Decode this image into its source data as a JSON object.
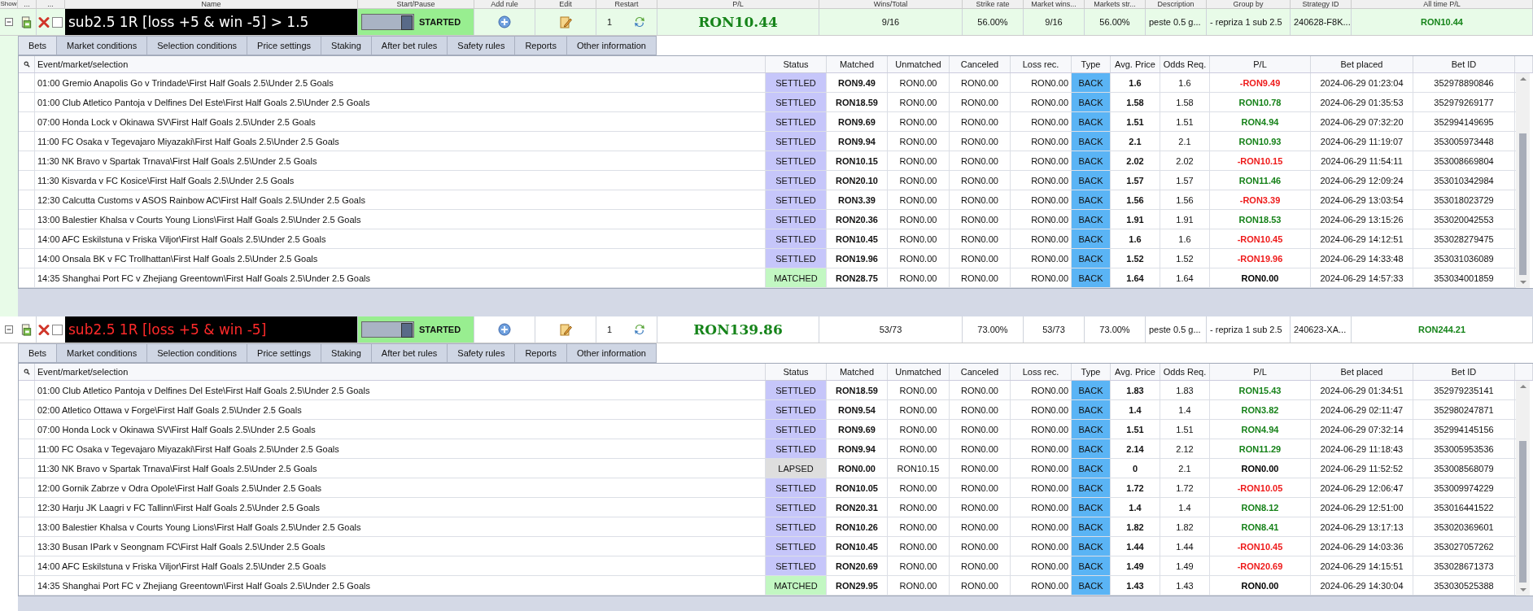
{
  "columns": [
    "Show",
    "...",
    "...",
    "Name",
    "Start/Pause",
    "Add rule",
    "Edit",
    "Restart",
    "P/L",
    "Wins/Total",
    "Strike rate",
    "Market wins...",
    "Markets str...",
    "Description",
    "Group by",
    "Strategy ID",
    "All time P/L"
  ],
  "strategies": [
    {
      "selected": true,
      "expanded": true,
      "checked": false,
      "name": "sub2.5 1R [loss +5 & win -5] > 1.5",
      "name_alert": false,
      "running": true,
      "state": "STARTED",
      "restart": "1",
      "pl": "RON10.44",
      "wins_total": "9/16",
      "strike_rate": "56.00%",
      "market_wins": "9/16",
      "markets_strike": "56.00%",
      "description": "peste 0.5 g...",
      "group_by": "- repriza 1 sub 2.5",
      "strategy_id": "240628-F8K...",
      "all_time_pl": "RON10.44",
      "tabs": [
        {
          "label": "Bets",
          "selected": true
        },
        {
          "label": "Market conditions",
          "selected": false
        },
        {
          "label": "Selection conditions",
          "selected": false
        },
        {
          "label": "Price settings",
          "selected": false
        },
        {
          "label": "Staking",
          "selected": false
        },
        {
          "label": "After bet rules",
          "selected": false
        },
        {
          "label": "Safety rules",
          "selected": false
        },
        {
          "label": "Reports",
          "selected": false
        },
        {
          "label": "Other information",
          "selected": false
        }
      ],
      "table_columns": [
        "Event/market/selection",
        "Status",
        "Matched",
        "Unmatched",
        "Canceled",
        "Loss rec.",
        "Type",
        "Avg. Price",
        "Odds Req.",
        "P/L",
        "Bet placed",
        "Bet ID"
      ],
      "bets": [
        {
          "kind": "settled",
          "event": "01:00 Gremio Anapolis Go v Trindade\\First Half Goals 2.5\\Under 2.5 Goals",
          "status": "SETTLED",
          "matched": "RON9.49",
          "unmatched": "RON0.00",
          "canceled": "RON0.00",
          "loss_rec": "RON0.00",
          "type": "BACK",
          "avg_price": "1.6",
          "odds_req": "1.6",
          "pl": {
            "text": "-RON9.49",
            "color": "#ee1b1b"
          },
          "bet_placed": "2024-06-29 01:23:04",
          "bet_id": "352978890846"
        },
        {
          "kind": "settled",
          "event": "01:00 Club Atletico Pantoja v Delfines Del Este\\First Half Goals 2.5\\Under 2.5 Goals",
          "status": "SETTLED",
          "matched": "RON18.59",
          "unmatched": "RON0.00",
          "canceled": "RON0.00",
          "loss_rec": "RON0.00",
          "type": "BACK",
          "avg_price": "1.58",
          "odds_req": "1.58",
          "pl": {
            "text": "RON10.78",
            "color": "#17821a"
          },
          "bet_placed": "2024-06-29 01:35:53",
          "bet_id": "352979269177"
        },
        {
          "kind": "settled",
          "event": "07:00 Honda Lock v Okinawa SV\\First Half Goals 2.5\\Under 2.5 Goals",
          "status": "SETTLED",
          "matched": "RON9.69",
          "unmatched": "RON0.00",
          "canceled": "RON0.00",
          "loss_rec": "RON0.00",
          "type": "BACK",
          "avg_price": "1.51",
          "odds_req": "1.51",
          "pl": {
            "text": "RON4.94",
            "color": "#17821a"
          },
          "bet_placed": "2024-06-29 07:32:20",
          "bet_id": "352994149695"
        },
        {
          "kind": "settled",
          "event": "11:00 FC Osaka v Tegevajaro Miyazaki\\First Half Goals 2.5\\Under 2.5 Goals",
          "status": "SETTLED",
          "matched": "RON9.94",
          "unmatched": "RON0.00",
          "canceled": "RON0.00",
          "loss_rec": "RON0.00",
          "type": "BACK",
          "avg_price": "2.1",
          "odds_req": "2.1",
          "pl": {
            "text": "RON10.93",
            "color": "#17821a"
          },
          "bet_placed": "2024-06-29 11:19:07",
          "bet_id": "353005973448"
        },
        {
          "kind": "settled",
          "event": "11:30 NK Bravo v Spartak Trnava\\First Half Goals 2.5\\Under 2.5 Goals",
          "status": "SETTLED",
          "matched": "RON10.15",
          "unmatched": "RON0.00",
          "canceled": "RON0.00",
          "loss_rec": "RON0.00",
          "type": "BACK",
          "avg_price": "2.02",
          "odds_req": "2.02",
          "pl": {
            "text": "-RON10.15",
            "color": "#ee1b1b"
          },
          "bet_placed": "2024-06-29 11:54:11",
          "bet_id": "353008669804"
        },
        {
          "kind": "settled",
          "event": "11:30 Kisvarda v FC Kosice\\First Half Goals 2.5\\Under 2.5 Goals",
          "status": "SETTLED",
          "matched": "RON20.10",
          "unmatched": "RON0.00",
          "canceled": "RON0.00",
          "loss_rec": "RON0.00",
          "type": "BACK",
          "avg_price": "1.57",
          "odds_req": "1.57",
          "pl": {
            "text": "RON11.46",
            "color": "#17821a"
          },
          "bet_placed": "2024-06-29 12:09:24",
          "bet_id": "353010342984"
        },
        {
          "kind": "settled",
          "event": "12:30 Calcutta Customs v ASOS Rainbow AC\\First Half Goals 2.5\\Under 2.5 Goals",
          "status": "SETTLED",
          "matched": "RON3.39",
          "unmatched": "RON0.00",
          "canceled": "RON0.00",
          "loss_rec": "RON0.00",
          "type": "BACK",
          "avg_price": "1.56",
          "odds_req": "1.56",
          "pl": {
            "text": "-RON3.39",
            "color": "#ee1b1b"
          },
          "bet_placed": "2024-06-29 13:03:54",
          "bet_id": "353018023729"
        },
        {
          "kind": "settled",
          "event": "13:00 Balestier Khalsa v Courts Young Lions\\First Half Goals 2.5\\Under 2.5 Goals",
          "status": "SETTLED",
          "matched": "RON20.36",
          "unmatched": "RON0.00",
          "canceled": "RON0.00",
          "loss_rec": "RON0.00",
          "type": "BACK",
          "avg_price": "1.91",
          "odds_req": "1.91",
          "pl": {
            "text": "RON18.53",
            "color": "#17821a"
          },
          "bet_placed": "2024-06-29 13:15:26",
          "bet_id": "353020042553"
        },
        {
          "kind": "settled",
          "event": "14:00 AFC Eskilstuna v Friska Viljor\\First Half Goals 2.5\\Under 2.5 Goals",
          "status": "SETTLED",
          "matched": "RON10.45",
          "unmatched": "RON0.00",
          "canceled": "RON0.00",
          "loss_rec": "RON0.00",
          "type": "BACK",
          "avg_price": "1.6",
          "odds_req": "1.6",
          "pl": {
            "text": "-RON10.45",
            "color": "#ee1b1b"
          },
          "bet_placed": "2024-06-29 14:12:51",
          "bet_id": "353028279475"
        },
        {
          "kind": "settled",
          "event": "14:00 Onsala BK v FC Trollhattan\\First Half Goals 2.5\\Under 2.5 Goals",
          "status": "SETTLED",
          "matched": "RON19.96",
          "unmatched": "RON0.00",
          "canceled": "RON0.00",
          "loss_rec": "RON0.00",
          "type": "BACK",
          "avg_price": "1.52",
          "odds_req": "1.52",
          "pl": {
            "text": "-RON19.96",
            "color": "#ee1b1b"
          },
          "bet_placed": "2024-06-29 14:33:48",
          "bet_id": "353031036089"
        },
        {
          "kind": "matched",
          "event": "14:35 Shanghai Port FC v Zhejiang Greentown\\First Half Goals 2.5\\Under 2.5 Goals",
          "status": "MATCHED",
          "matched": "RON28.75",
          "unmatched": "RON0.00",
          "canceled": "RON0.00",
          "loss_rec": "RON0.00",
          "type": "BACK",
          "avg_price": "1.64",
          "odds_req": "1.64",
          "pl": {
            "text": "RON0.00",
            "color": "#000000"
          },
          "bet_placed": "2024-06-29 14:57:33",
          "bet_id": "353034001859"
        }
      ]
    },
    {
      "selected": false,
      "expanded": true,
      "checked": false,
      "name": "sub2.5 1R [loss +5 & win -5]",
      "name_alert": true,
      "running": true,
      "state": "STARTED",
      "restart": "1",
      "pl": "RON139.86",
      "wins_total": "53/73",
      "strike_rate": "73.00%",
      "market_wins": "53/73",
      "markets_strike": "73.00%",
      "description": "peste 0.5 g...",
      "group_by": "- repriza 1 sub 2.5",
      "strategy_id": "240623-XA...",
      "all_time_pl": "RON244.21",
      "tabs": [
        {
          "label": "Bets",
          "selected": true
        },
        {
          "label": "Market conditions",
          "selected": false
        },
        {
          "label": "Selection conditions",
          "selected": false
        },
        {
          "label": "Price settings",
          "selected": false
        },
        {
          "label": "Staking",
          "selected": false
        },
        {
          "label": "After bet rules",
          "selected": false
        },
        {
          "label": "Safety rules",
          "selected": false
        },
        {
          "label": "Reports",
          "selected": false
        },
        {
          "label": "Other information",
          "selected": false
        }
      ],
      "table_columns": [
        "Event/market/selection",
        "Status",
        "Matched",
        "Unmatched",
        "Canceled",
        "Loss rec.",
        "Type",
        "Avg. Price",
        "Odds Req.",
        "P/L",
        "Bet placed",
        "Bet ID"
      ],
      "bets": [
        {
          "kind": "settled",
          "event": "01:00 Club Atletico Pantoja v Delfines Del Este\\First Half Goals 2.5\\Under 2.5 Goals",
          "status": "SETTLED",
          "matched": "RON18.59",
          "unmatched": "RON0.00",
          "canceled": "RON0.00",
          "loss_rec": "RON0.00",
          "type": "BACK",
          "avg_price": "1.83",
          "odds_req": "1.83",
          "pl": {
            "text": "RON15.43",
            "color": "#17821a"
          },
          "bet_placed": "2024-06-29 01:34:51",
          "bet_id": "352979235141"
        },
        {
          "kind": "settled",
          "event": "02:00 Atletico Ottawa v Forge\\First Half Goals 2.5\\Under 2.5 Goals",
          "status": "SETTLED",
          "matched": "RON9.54",
          "unmatched": "RON0.00",
          "canceled": "RON0.00",
          "loss_rec": "RON0.00",
          "type": "BACK",
          "avg_price": "1.4",
          "odds_req": "1.4",
          "pl": {
            "text": "RON3.82",
            "color": "#17821a"
          },
          "bet_placed": "2024-06-29 02:11:47",
          "bet_id": "352980247871"
        },
        {
          "kind": "settled",
          "event": "07:00 Honda Lock v Okinawa SV\\First Half Goals 2.5\\Under 2.5 Goals",
          "status": "SETTLED",
          "matched": "RON9.69",
          "unmatched": "RON0.00",
          "canceled": "RON0.00",
          "loss_rec": "RON0.00",
          "type": "BACK",
          "avg_price": "1.51",
          "odds_req": "1.51",
          "pl": {
            "text": "RON4.94",
            "color": "#17821a"
          },
          "bet_placed": "2024-06-29 07:32:14",
          "bet_id": "352994145156"
        },
        {
          "kind": "settled",
          "event": "11:00 FC Osaka v Tegevajaro Miyazaki\\First Half Goals 2.5\\Under 2.5 Goals",
          "status": "SETTLED",
          "matched": "RON9.94",
          "unmatched": "RON0.00",
          "canceled": "RON0.00",
          "loss_rec": "RON0.00",
          "type": "BACK",
          "avg_price": "2.14",
          "odds_req": "2.12",
          "pl": {
            "text": "RON11.29",
            "color": "#17821a"
          },
          "bet_placed": "2024-06-29 11:18:43",
          "bet_id": "353005953536"
        },
        {
          "kind": "lapsed",
          "event": "11:30 NK Bravo v Spartak Trnava\\First Half Goals 2.5\\Under 2.5 Goals",
          "status": "LAPSED",
          "matched": "RON0.00",
          "unmatched": "RON10.15",
          "canceled": "RON0.00",
          "loss_rec": "RON0.00",
          "type": "BACK",
          "avg_price": "0",
          "odds_req": "2.1",
          "pl": {
            "text": "RON0.00",
            "color": "#000000"
          },
          "bet_placed": "2024-06-29 11:52:52",
          "bet_id": "353008568079"
        },
        {
          "kind": "settled",
          "event": "12:00 Gornik Zabrze v Odra Opole\\First Half Goals 2.5\\Under 2.5 Goals",
          "status": "SETTLED",
          "matched": "RON10.05",
          "unmatched": "RON0.00",
          "canceled": "RON0.00",
          "loss_rec": "RON0.00",
          "type": "BACK",
          "avg_price": "1.72",
          "odds_req": "1.72",
          "pl": {
            "text": "-RON10.05",
            "color": "#ee1b1b"
          },
          "bet_placed": "2024-06-29 12:06:47",
          "bet_id": "353009974229"
        },
        {
          "kind": "settled",
          "event": "12:30 Harju JK Laagri v FC Tallinn\\First Half Goals 2.5\\Under 2.5 Goals",
          "status": "SETTLED",
          "matched": "RON20.31",
          "unmatched": "RON0.00",
          "canceled": "RON0.00",
          "loss_rec": "RON0.00",
          "type": "BACK",
          "avg_price": "1.4",
          "odds_req": "1.4",
          "pl": {
            "text": "RON8.12",
            "color": "#17821a"
          },
          "bet_placed": "2024-06-29 12:51:00",
          "bet_id": "353016441522"
        },
        {
          "kind": "settled",
          "event": "13:00 Balestier Khalsa v Courts Young Lions\\First Half Goals 2.5\\Under 2.5 Goals",
          "status": "SETTLED",
          "matched": "RON10.26",
          "unmatched": "RON0.00",
          "canceled": "RON0.00",
          "loss_rec": "RON0.00",
          "type": "BACK",
          "avg_price": "1.82",
          "odds_req": "1.82",
          "pl": {
            "text": "RON8.41",
            "color": "#17821a"
          },
          "bet_placed": "2024-06-29 13:17:13",
          "bet_id": "353020369601"
        },
        {
          "kind": "settled",
          "event": "13:30 Busan IPark v Seongnam FC\\First Half Goals 2.5\\Under 2.5 Goals",
          "status": "SETTLED",
          "matched": "RON10.45",
          "unmatched": "RON0.00",
          "canceled": "RON0.00",
          "loss_rec": "RON0.00",
          "type": "BACK",
          "avg_price": "1.44",
          "odds_req": "1.44",
          "pl": {
            "text": "-RON10.45",
            "color": "#ee1b1b"
          },
          "bet_placed": "2024-06-29 14:03:36",
          "bet_id": "353027057262"
        },
        {
          "kind": "settled",
          "event": "14:00 AFC Eskilstuna v Friska Viljor\\First Half Goals 2.5\\Under 2.5 Goals",
          "status": "SETTLED",
          "matched": "RON20.69",
          "unmatched": "RON0.00",
          "canceled": "RON0.00",
          "loss_rec": "RON0.00",
          "type": "BACK",
          "avg_price": "1.49",
          "odds_req": "1.49",
          "pl": {
            "text": "-RON20.69",
            "color": "#ee1b1b"
          },
          "bet_placed": "2024-06-29 14:15:51",
          "bet_id": "353028671373"
        },
        {
          "kind": "matched",
          "event": "14:35 Shanghai Port FC v Zhejiang Greentown\\First Half Goals 2.5\\Under 2.5 Goals",
          "status": "MATCHED",
          "matched": "RON29.95",
          "unmatched": "RON0.00",
          "canceled": "RON0.00",
          "loss_rec": "RON0.00",
          "type": "BACK",
          "avg_price": "1.43",
          "odds_req": "1.43",
          "pl": {
            "text": "RON0.00",
            "color": "#000000"
          },
          "bet_placed": "2024-06-29 14:30:04",
          "bet_id": "353030525388"
        }
      ]
    }
  ]
}
